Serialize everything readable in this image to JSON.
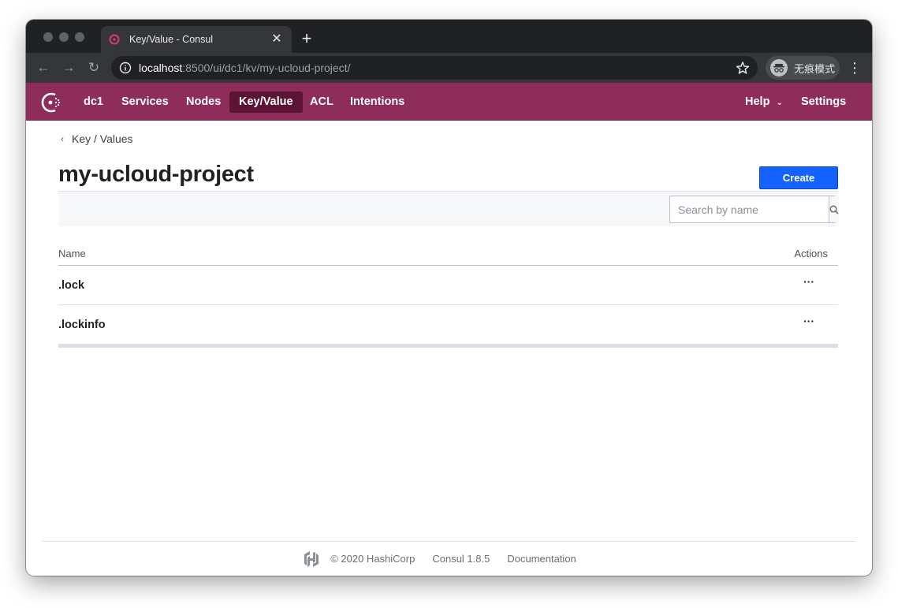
{
  "browser": {
    "tab_title": "Key/Value - Consul",
    "url_host": "localhost",
    "url_path": ":8500/ui/dc1/kv/my-ucloud-project/",
    "incognito_label": "无痕模式"
  },
  "nav": {
    "datacenter": "dc1",
    "items": [
      {
        "label": "Services"
      },
      {
        "label": "Nodes"
      },
      {
        "label": "Key/Value",
        "active": true
      },
      {
        "label": "ACL"
      },
      {
        "label": "Intentions"
      }
    ],
    "help": "Help",
    "settings": "Settings",
    "bg_color": "#8e2c5a"
  },
  "page": {
    "breadcrumb": "Key / Values",
    "title": "my-ucloud-project",
    "create_label": "Create",
    "search_placeholder": "Search by name"
  },
  "table": {
    "columns": [
      "Name",
      "Actions"
    ],
    "rows": [
      {
        "name": ".lock",
        "actions": "···"
      },
      {
        "name": ".lockinfo",
        "actions": "···"
      }
    ]
  },
  "footer": {
    "copyright": "© 2020 HashiCorp",
    "version": "Consul 1.8.5",
    "docs": "Documentation"
  }
}
